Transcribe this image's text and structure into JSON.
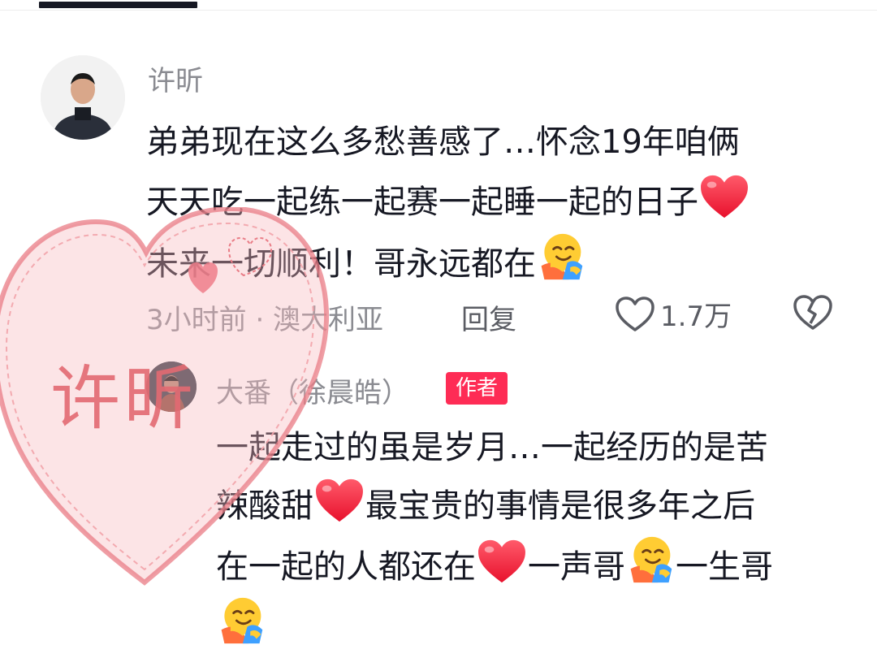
{
  "colors": {
    "accent": "#fe2c55",
    "text": "#161823",
    "secondary": "#8a8b91",
    "watermark": "#e36a72"
  },
  "comments": [
    {
      "username": "许昕",
      "lines": [
        "弟弟现在这么多愁善感了…怀念19年咱俩",
        "天天吃一起练一起赛一起睡一起的日子",
        "未来一切顺利！哥永远都在"
      ],
      "time_location": "3小时前 · 澳大利亚",
      "reply_label": "回复",
      "like_count": "1.7万"
    },
    {
      "username": "大番（徐晨皓）",
      "badge": "作者",
      "lines": [
        "一起走过的虽是岁月…一起经历的是苦",
        "辣酸甜",
        "最宝贵的事情是很多年之后",
        "在一起的人都还在",
        "一声哥",
        "一生哥"
      ]
    }
  ],
  "icons": [
    "heart-emoji",
    "hug-emoji",
    "like-heart-icon",
    "dislike-broken-heart-icon"
  ],
  "watermark": {
    "text": "许昕"
  }
}
